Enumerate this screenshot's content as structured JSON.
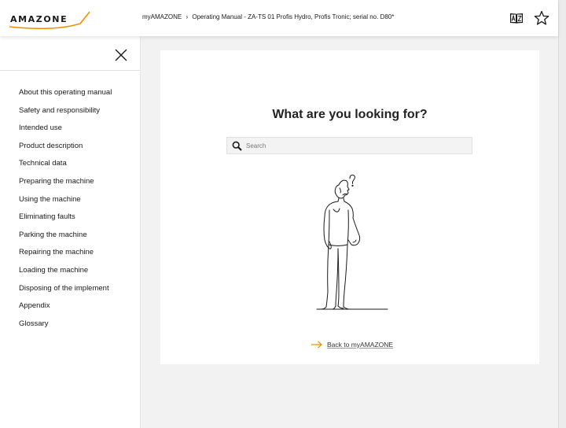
{
  "brand": {
    "name": "AMAZONE",
    "accent_color": "#f29100"
  },
  "header": {
    "breadcrumb": {
      "root": "myAMAZONE",
      "separator": "›",
      "current": "Operating Manual - ZA-TS 01 Profis Hydro, Profis Tronic; serial no. D80*"
    },
    "icons": {
      "language": "book-language-icon",
      "favorite": "star-icon"
    }
  },
  "sidebar": {
    "close_icon": "close-icon",
    "items": [
      "About this operating manual",
      "Safety and responsibility",
      "Intended use",
      "Product description",
      "Technical data",
      "Preparing the machine",
      "Using the machine",
      "Eliminating faults",
      "Parking the machine",
      "Repairing the machine",
      "Loading the machine",
      "Disposing of the implement",
      "Appendix",
      "Glossary"
    ]
  },
  "main": {
    "heading": "What are you looking for?",
    "search": {
      "placeholder": "Search",
      "value": ""
    },
    "back_link": "Back to myAMAZONE"
  }
}
